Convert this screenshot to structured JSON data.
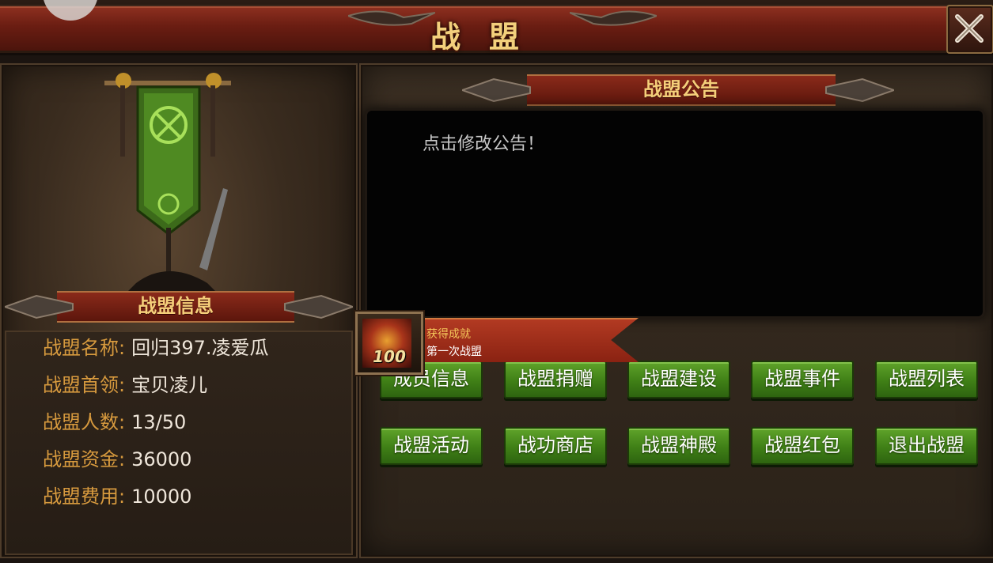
{
  "header": {
    "title": "战盟"
  },
  "notice": {
    "heading": "战盟公告",
    "text": "点击修改公告！"
  },
  "info": {
    "heading": "战盟信息",
    "rows": [
      {
        "label": "战盟名称:",
        "value": "回归397.凌爱瓜"
      },
      {
        "label": "战盟首领:",
        "value": "宝贝凌儿"
      },
      {
        "label": "战盟人数:",
        "value": "13/50"
      },
      {
        "label": "战盟资金:",
        "value": "36000"
      },
      {
        "label": "战盟费用:",
        "value": "10000"
      }
    ]
  },
  "buttons": {
    "row1": [
      "成员信息",
      "战盟捐赠",
      "战盟建设",
      "战盟事件",
      "战盟列表"
    ],
    "row2": [
      "战盟活动",
      "战功商店",
      "战盟神殿",
      "战盟红包",
      "退出战盟"
    ]
  },
  "achievement": {
    "title": "获得成就",
    "name": "第一次战盟",
    "level": "100"
  },
  "icons": [
    "gear-icon",
    "close-icon",
    "banner-icon",
    "achievement-badge-icon"
  ],
  "colors": {
    "accent_red": "#8e3020",
    "title_gold": "#f3d07c",
    "label_orange": "#d79a3e",
    "button_green": "#4f9020"
  }
}
